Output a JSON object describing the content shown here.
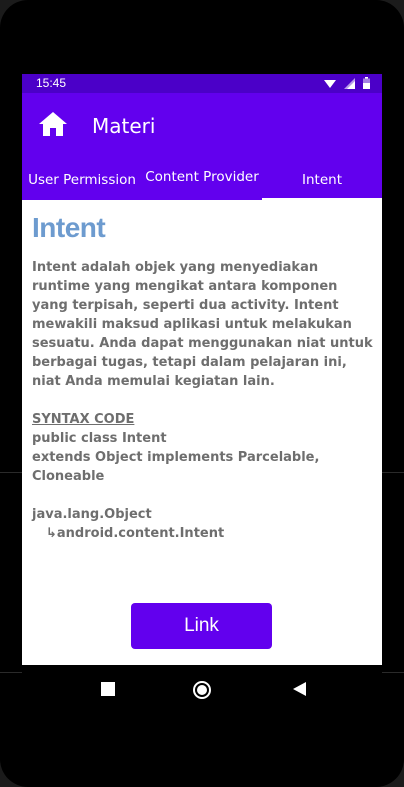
{
  "status_bar": {
    "time": "15:45"
  },
  "app_bar": {
    "title": "Materi"
  },
  "tabs": [
    {
      "label": "User Permission"
    },
    {
      "label": "Content Provider"
    },
    {
      "label": "Intent"
    }
  ],
  "content": {
    "heading": "Intent",
    "paragraph": "Intent adalah objek yang menyediakan runtime yang mengikat antara komponen yang terpisah, seperti dua activity. Intent mewakili maksud aplikasi untuk melakukan sesuatu. Anda dapat menggunakan niat untuk berbagai tugas, tetapi dalam pelajaran ini, niat Anda memulai kegiatan lain.",
    "syntax_title": "SYNTAX CODE",
    "syntax_line1": "public class Intent",
    "syntax_line2": "extends Object implements Parcelable, Cloneable",
    "hierarchy_parent": "java.lang.Object",
    "hierarchy_child": "↳android.content.Intent"
  },
  "button": {
    "label": "Link"
  },
  "colors": {
    "primary": "#6200ee",
    "status": "#4b00c8",
    "heading": "#6d9bcf"
  },
  "icons": {
    "home": "home-icon",
    "wifi": "wifi-icon",
    "signal": "signal-icon",
    "battery": "battery-icon",
    "back": "back-icon",
    "home_nav": "home-nav-icon",
    "recents": "recents-icon"
  }
}
